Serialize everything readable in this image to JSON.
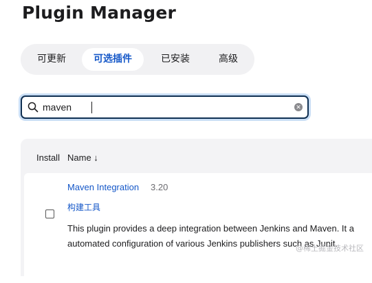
{
  "header": {
    "title": "Plugin Manager"
  },
  "tabs": [
    {
      "label": "可更新"
    },
    {
      "label": "可选插件"
    },
    {
      "label": "已安装"
    },
    {
      "label": "高级"
    }
  ],
  "search": {
    "value": "maven",
    "icon": "search-icon",
    "clear_icon": "clear-icon"
  },
  "table": {
    "headers": {
      "install": "Install",
      "name": "Name ↓"
    },
    "rows": [
      {
        "name": "Maven Integration",
        "version": "3.20",
        "tag": "构建工具",
        "description_line1": "This plugin provides a deep integration between Jenkins and Maven. It a",
        "description_line2": "automated configuration of various Jenkins publishers such as Junit."
      }
    ]
  },
  "watermark": "@稀土掘金技术社区",
  "colors": {
    "accent": "#1457c8",
    "focus_border": "#0f2f52"
  }
}
